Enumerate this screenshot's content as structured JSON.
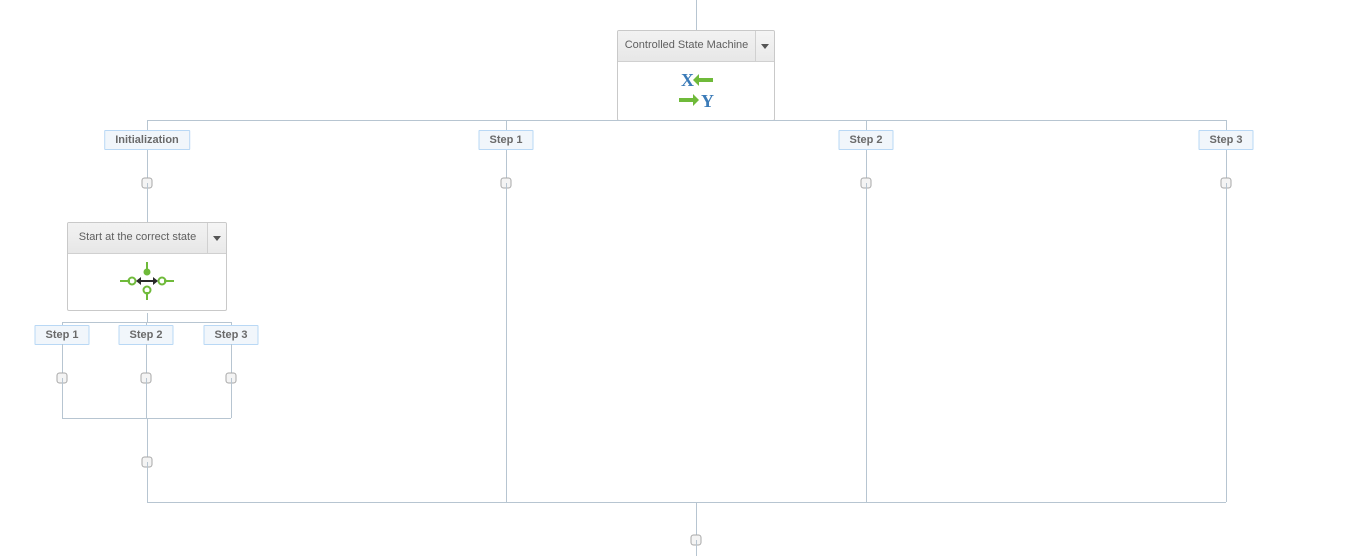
{
  "nodes": {
    "root": {
      "title": "Controlled State Machine"
    },
    "init_switch": {
      "title": "Start at the correct state"
    }
  },
  "branches": {
    "b0": "Initialization",
    "b1": "Step 1",
    "b2": "Step 2",
    "b3": "Step 3"
  },
  "init_sub_branches": {
    "s0": "Step 1",
    "s1": "Step 2",
    "s2": "Step 3"
  },
  "colors": {
    "connector": "#b7c5d1",
    "branch_bg": "#f1f6fb",
    "branch_border": "#b9d8f5",
    "icon_blue": "#3b7bb8",
    "icon_green": "#6fba3a"
  }
}
